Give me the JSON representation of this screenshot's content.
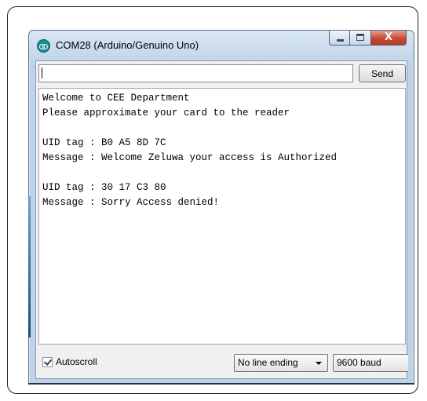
{
  "window": {
    "title": "COM28 (Arduino/Genuino Uno)",
    "icon": "arduino-icon",
    "controls": {
      "minimize": "minimize-icon",
      "maximize": "maximize-icon",
      "close": "X"
    }
  },
  "input": {
    "value": "",
    "placeholder": ""
  },
  "send_label": "Send",
  "output_lines": [
    "Welcome to CEE Department",
    "Please approximate your card to the reader",
    "",
    "UID tag : B0 A5 8D 7C",
    "Message : Welcome Zeluwa your access is Authorized",
    "",
    "UID tag : 30 17 C3 80",
    "Message : Sorry Access denied!"
  ],
  "status_bar": {
    "autoscroll_label": "Autoscroll",
    "autoscroll_checked": true,
    "line_ending": "No line ending",
    "baud": "9600 baud"
  },
  "colors": {
    "titlebar": "#c2d5ea",
    "close_button": "#c74a33",
    "client_bg": "#f0f0f0"
  }
}
